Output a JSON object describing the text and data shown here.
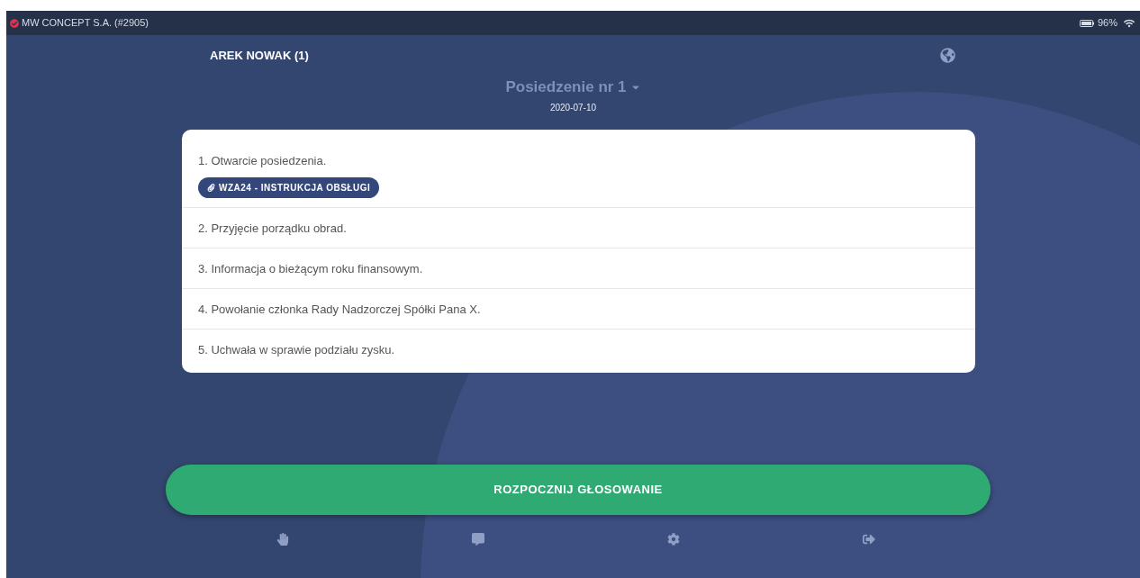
{
  "status_bar": {
    "company": "MW CONCEPT S.A. (#2905)",
    "battery": "96%"
  },
  "user": {
    "name": "AREK NOWAK (1)"
  },
  "meeting": {
    "title": "Posiedzenie nr 1",
    "date": "2020-07-10"
  },
  "agenda": [
    {
      "number": "1.",
      "title": "Otwarcie posiedzenia.",
      "attachments": [
        "WZA24 - INSTRUKCJA OBSŁUGI"
      ]
    },
    {
      "number": "2.",
      "title": "Przyjęcie porządku obrad."
    },
    {
      "number": "3.",
      "title": "Informacja o bieżącym roku finansowym."
    },
    {
      "number": "4.",
      "title": "Powołanie członka Rady Nadzorczej Spółki Pana X."
    },
    {
      "number": "5.",
      "title": "Uchwała w sprawie podziału zysku."
    }
  ],
  "start_button": "ROZPOCZNIJ GŁOSOWANIE"
}
